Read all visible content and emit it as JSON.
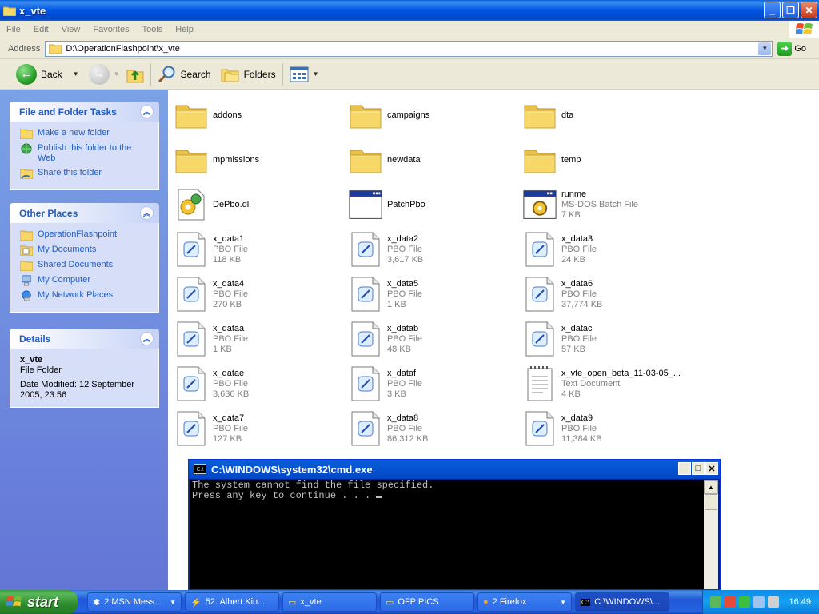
{
  "window": {
    "title": "x_vte"
  },
  "menu": [
    "File",
    "Edit",
    "View",
    "Favorites",
    "Tools",
    "Help"
  ],
  "address": {
    "label": "Address",
    "value": "D:\\OperationFlashpoint\\x_vte",
    "go": "Go"
  },
  "toolbar": {
    "back": "Back",
    "search": "Search",
    "folders": "Folders"
  },
  "tasks_panel": {
    "title": "File and Folder Tasks",
    "items": [
      "Make a new folder",
      "Publish this folder to the Web",
      "Share this folder"
    ]
  },
  "places_panel": {
    "title": "Other Places",
    "items": [
      "OperationFlashpoint",
      "My Documents",
      "Shared Documents",
      "My Computer",
      "My Network Places"
    ]
  },
  "details_panel": {
    "title": "Details",
    "name": "x_vte",
    "type": "File Folder",
    "modified": "Date Modified: 12 September 2005, 23:56"
  },
  "files": [
    {
      "name": "addons",
      "kind": "folder",
      "type": "",
      "size": ""
    },
    {
      "name": "campaigns",
      "kind": "folder",
      "type": "",
      "size": ""
    },
    {
      "name": "dta",
      "kind": "folder",
      "type": "",
      "size": ""
    },
    {
      "name": "mpmissions",
      "kind": "folder",
      "type": "",
      "size": ""
    },
    {
      "name": "newdata",
      "kind": "folder",
      "type": "",
      "size": ""
    },
    {
      "name": "temp",
      "kind": "folder",
      "type": "",
      "size": ""
    },
    {
      "name": "DePbo.dll",
      "kind": "dll",
      "type": "",
      "size": ""
    },
    {
      "name": "PatchPbo",
      "kind": "exe",
      "type": "",
      "size": ""
    },
    {
      "name": "runme",
      "kind": "bat",
      "type": "MS-DOS Batch File",
      "size": "7 KB"
    },
    {
      "name": "x_data1",
      "kind": "pbo",
      "type": "PBO File",
      "size": "118 KB"
    },
    {
      "name": "x_data2",
      "kind": "pbo",
      "type": "PBO File",
      "size": "3,617 KB"
    },
    {
      "name": "x_data3",
      "kind": "pbo",
      "type": "PBO File",
      "size": "24 KB"
    },
    {
      "name": "x_data4",
      "kind": "pbo",
      "type": "PBO File",
      "size": "270 KB"
    },
    {
      "name": "x_data5",
      "kind": "pbo",
      "type": "PBO File",
      "size": "1 KB"
    },
    {
      "name": "x_data6",
      "kind": "pbo",
      "type": "PBO File",
      "size": "37,774 KB"
    },
    {
      "name": "x_dataa",
      "kind": "pbo",
      "type": "PBO File",
      "size": "1 KB"
    },
    {
      "name": "x_datab",
      "kind": "pbo",
      "type": "PBO File",
      "size": "48 KB"
    },
    {
      "name": "x_datac",
      "kind": "pbo",
      "type": "PBO File",
      "size": "57 KB"
    },
    {
      "name": "x_datae",
      "kind": "pbo",
      "type": "PBO File",
      "size": "3,636 KB"
    },
    {
      "name": "x_dataf",
      "kind": "pbo",
      "type": "PBO File",
      "size": "3 KB"
    },
    {
      "name": "x_vte_open_beta_11-03-05_...",
      "kind": "txt",
      "type": "Text Document",
      "size": "4 KB"
    },
    {
      "name": "x_data7",
      "kind": "pbo",
      "type": "PBO File",
      "size": "127 KB"
    },
    {
      "name": "x_data8",
      "kind": "pbo",
      "type": "PBO File",
      "size": "86,312 KB"
    },
    {
      "name": "x_data9",
      "kind": "pbo",
      "type": "PBO File",
      "size": "11,384 KB"
    }
  ],
  "cmd": {
    "title": "C:\\WINDOWS\\system32\\cmd.exe",
    "icon_text": "C:\\",
    "line1": "The system cannot find the file specified.",
    "line2": "Press any key to continue . . . "
  },
  "taskbar": {
    "start": "start",
    "tasks": [
      "2 MSN Mess...",
      "52. Albert Kin...",
      "x_vte",
      "OFP PICS",
      "2 Firefox",
      "C:\\WINDOWS\\..."
    ],
    "clock": "16:49"
  },
  "colors": {
    "title_blue": "#0054e3",
    "taskpane_blue": "#6375d6",
    "link_blue": "#215dc6"
  }
}
